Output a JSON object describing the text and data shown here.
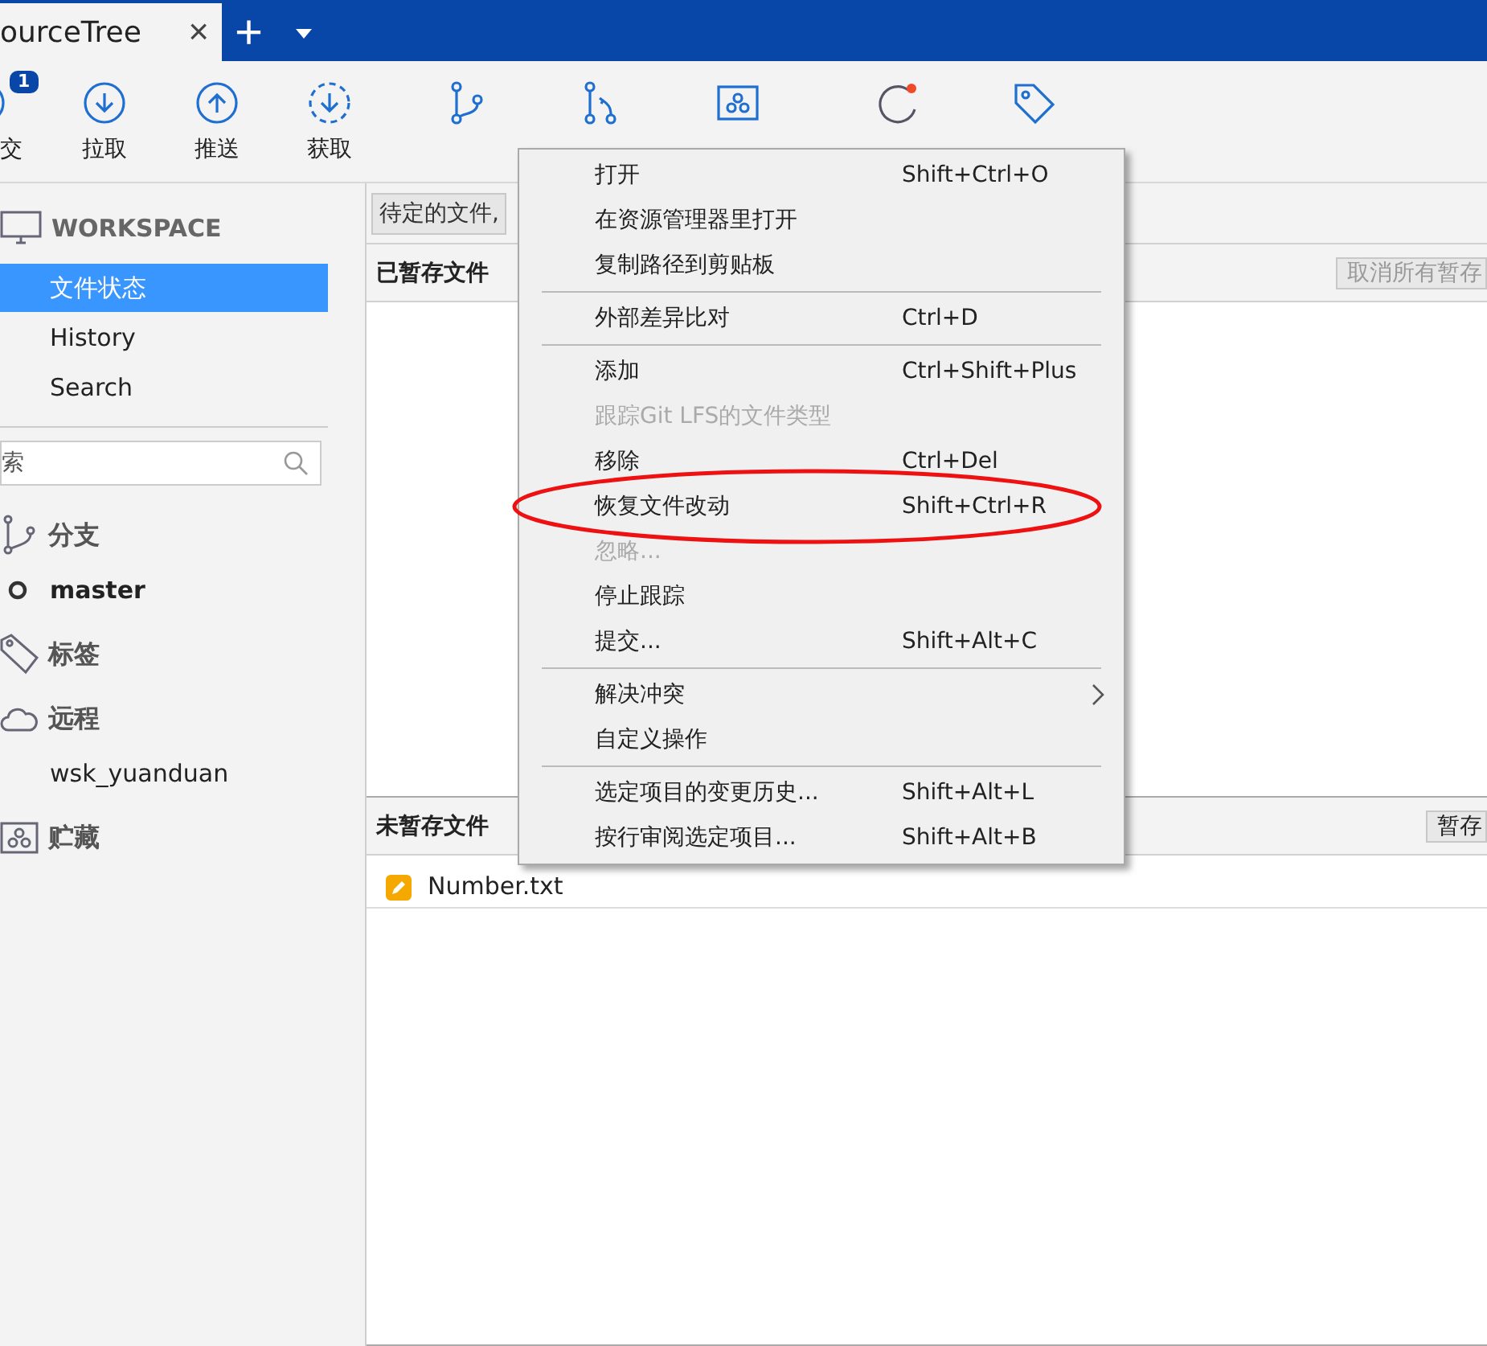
{
  "tab_bar": {
    "tab": {
      "title": "ourceTree",
      "close": "×"
    },
    "new_tab": "+"
  },
  "toolbar": [
    {
      "kind": "commit",
      "label": "交",
      "badge": "1"
    },
    {
      "kind": "pull",
      "label": "拉取"
    },
    {
      "kind": "push",
      "label": "推送"
    },
    {
      "kind": "fetch",
      "label": "获取"
    },
    {
      "kind": "branch"
    },
    {
      "kind": "merge"
    },
    {
      "kind": "stash"
    },
    {
      "kind": "discard"
    },
    {
      "kind": "tag"
    }
  ],
  "sidebar": {
    "workspace": "WORKSPACE",
    "items": [
      {
        "label": "文件状态",
        "selected": true
      },
      {
        "label": "History",
        "selected": false
      },
      {
        "label": "Search",
        "selected": false
      }
    ],
    "search": {
      "placeholder": "索"
    },
    "sections": [
      {
        "kind": "branch",
        "label": "分支",
        "children": [
          {
            "label": "master",
            "current": true
          }
        ]
      },
      {
        "kind": "tag",
        "label": "标签"
      },
      {
        "kind": "remote",
        "label": "远程",
        "children": [
          {
            "label": "wsk_yuanduan",
            "current": false
          }
        ]
      },
      {
        "kind": "stash",
        "label": "贮藏"
      }
    ]
  },
  "main": {
    "filter": "待定的文件,",
    "staged": {
      "title": "已暂存文件",
      "button": "取消所有暂存",
      "button_disabled": true
    },
    "unstaged": {
      "title": "未暂存文件",
      "button": "暂存",
      "button_disabled": false,
      "files": [
        {
          "name": "Number.txt"
        }
      ]
    }
  },
  "context_menu": [
    {
      "kind": "item",
      "label": "打开",
      "shortcut": "Shift+Ctrl+O",
      "disabled": false,
      "highlighted": false
    },
    {
      "kind": "item",
      "label": "在资源管理器里打开",
      "disabled": false,
      "highlighted": false
    },
    {
      "kind": "item",
      "label": "复制路径到剪贴板",
      "disabled": false,
      "highlighted": false
    },
    {
      "kind": "separator"
    },
    {
      "kind": "item",
      "label": "外部差异比对",
      "shortcut": "Ctrl+D",
      "disabled": false,
      "highlighted": false
    },
    {
      "kind": "separator"
    },
    {
      "kind": "item",
      "label": "添加",
      "shortcut": "Ctrl+Shift+Plus",
      "disabled": false,
      "highlighted": false
    },
    {
      "kind": "item",
      "label": "跟踪Git LFS的文件类型",
      "disabled": true,
      "highlighted": false
    },
    {
      "kind": "item",
      "label": "移除",
      "shortcut": "Ctrl+Del",
      "disabled": false,
      "highlighted": false
    },
    {
      "kind": "item",
      "label": "恢复文件改动",
      "shortcut": "Shift+Ctrl+R",
      "disabled": false,
      "highlighted": true
    },
    {
      "kind": "item",
      "label": "忽略...",
      "disabled": true,
      "highlighted": false
    },
    {
      "kind": "item",
      "label": "停止跟踪",
      "disabled": false,
      "highlighted": false
    },
    {
      "kind": "item",
      "label": "提交...",
      "shortcut": "Shift+Alt+C",
      "disabled": false,
      "highlighted": false
    },
    {
      "kind": "separator"
    },
    {
      "kind": "submenu",
      "label": "解决冲突",
      "disabled": false,
      "highlighted": false
    },
    {
      "kind": "item",
      "label": "自定义操作",
      "disabled": false,
      "highlighted": false
    },
    {
      "kind": "separator"
    },
    {
      "kind": "item",
      "label": "选定项目的变更历史...",
      "shortcut": "Shift+Alt+L",
      "disabled": false,
      "highlighted": false
    },
    {
      "kind": "item",
      "label": "按行审阅选定项目...",
      "shortcut": "Shift+Alt+B",
      "disabled": false,
      "highlighted": false
    }
  ]
}
